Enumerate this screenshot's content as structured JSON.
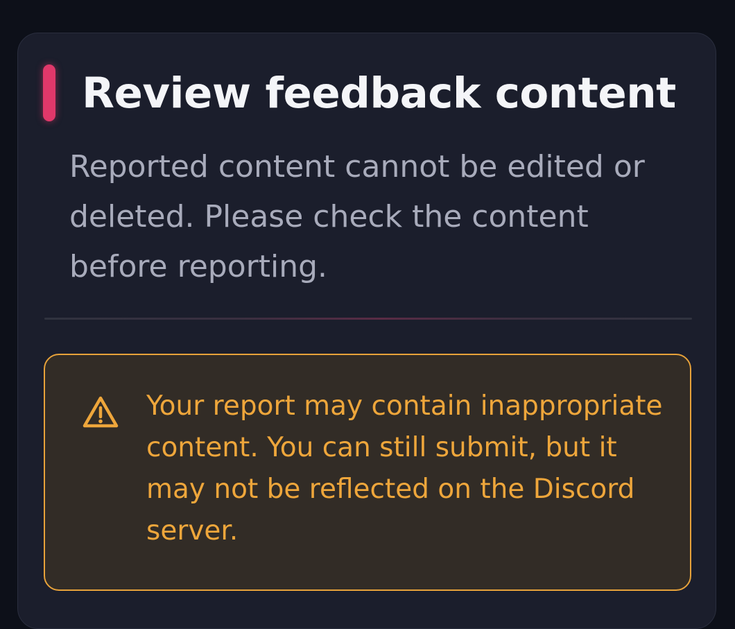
{
  "dialog": {
    "title": "Review feedback content",
    "description": "Reported content cannot be edited or deleted. Please check the content before reporting.",
    "accent_color": "#e0386a"
  },
  "warning": {
    "icon": "warning-triangle-icon",
    "message": "Your report may contain inappropriate content. You can still submit, but it may not be reflected on the Discord server.",
    "color": "#eea63b"
  }
}
